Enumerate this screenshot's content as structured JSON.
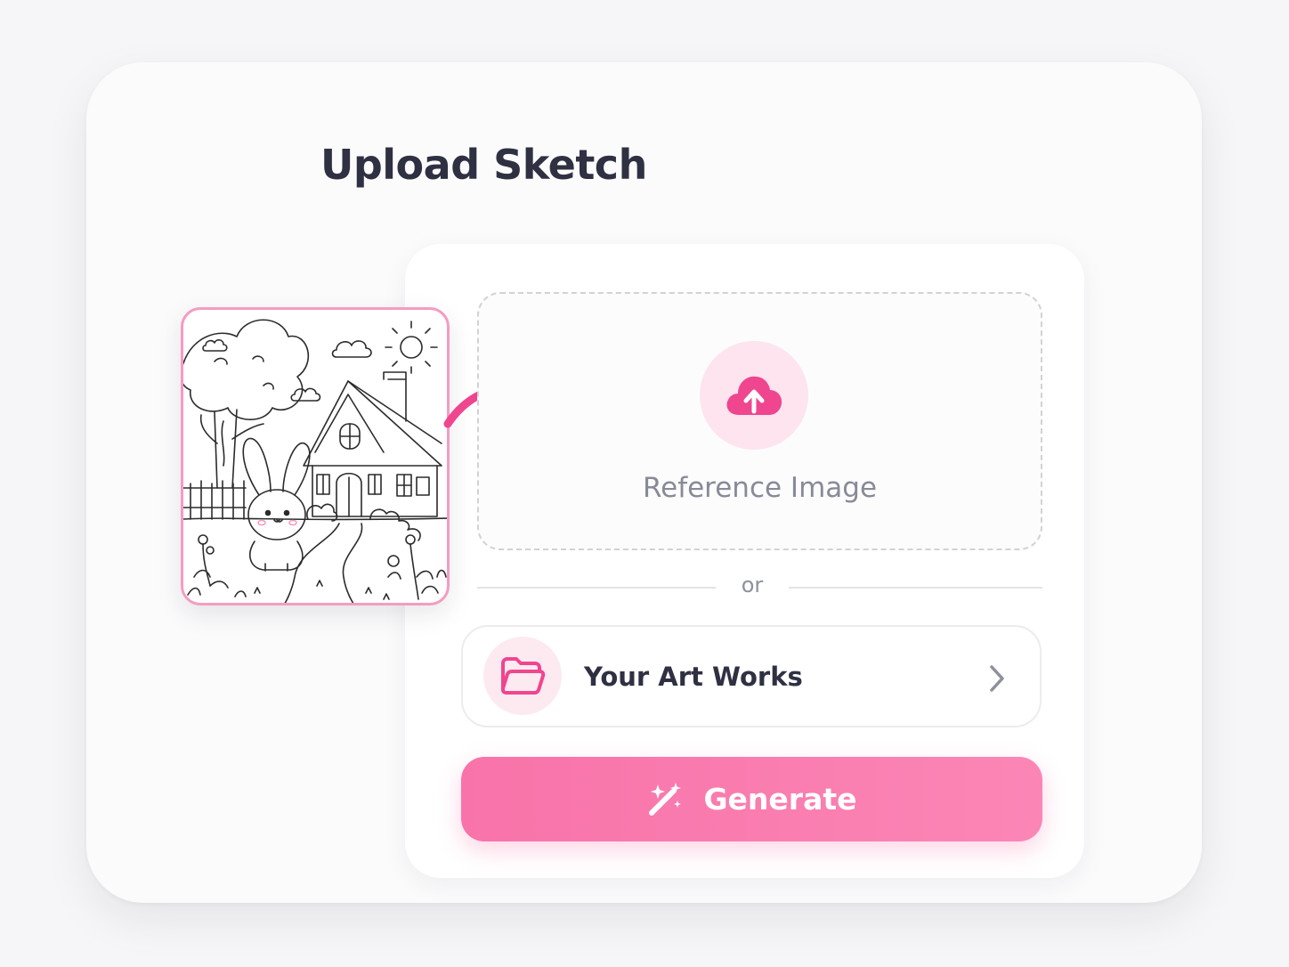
{
  "title": "Upload Sketch",
  "dropzone": {
    "label": "Reference Image",
    "icon": "cloud-upload-icon"
  },
  "divider": {
    "text": "or"
  },
  "artworks": {
    "label": "Your Art Works",
    "icon": "folder-icon",
    "chevron_icon": "chevron-right-icon"
  },
  "generate": {
    "label": "Generate",
    "icon": "magic-wand-icon"
  },
  "sketch_preview": {
    "icon": "coloring-sketch-bunny-house"
  },
  "colors": {
    "accent": "#f0458f",
    "accent_soft": "#fde4ee",
    "button": "#f873a9",
    "title": "#2f3142",
    "muted": "#888a97"
  }
}
